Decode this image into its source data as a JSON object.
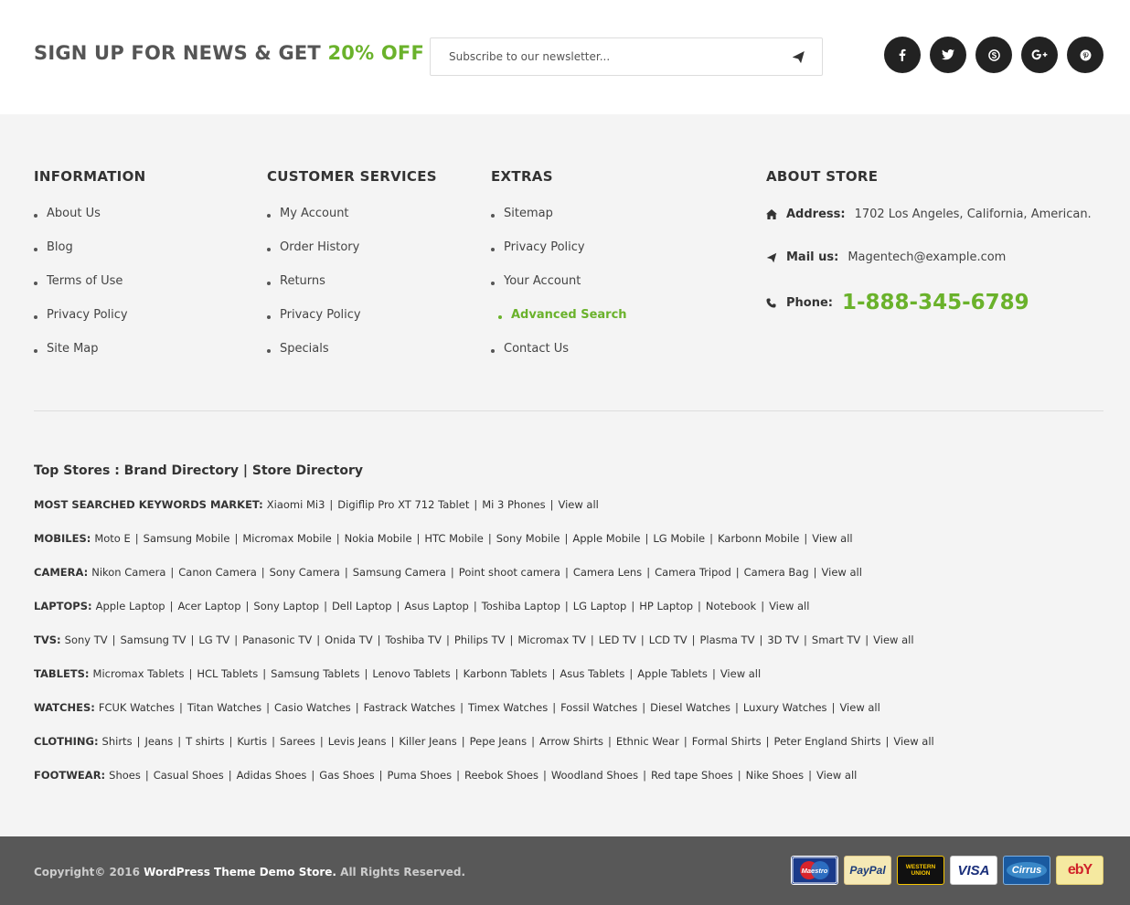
{
  "newsletter": {
    "title_prefix": "SIGN UP FOR NEWS & GET",
    "title_accent": "20% OFF",
    "placeholder": "Subscribe to our newsletter...",
    "social": [
      "facebook-icon",
      "twitter-icon",
      "skype-icon",
      "google-plus-icon",
      "pinterest-icon"
    ]
  },
  "columns": {
    "information": {
      "title": "INFORMATION",
      "items": [
        "About Us",
        "Blog",
        "Terms of Use",
        "Privacy Policy",
        "Site Map"
      ]
    },
    "customer_services": {
      "title": "CUSTOMER SERVICES",
      "items": [
        "My Account",
        "Order History",
        "Returns",
        "Privacy Policy",
        "Specials"
      ]
    },
    "extras": {
      "title": "EXTRAS",
      "items": [
        "Sitemap",
        "Privacy Policy",
        "Your Account",
        "Advanced Search",
        "Contact Us"
      ],
      "active_index": 3
    },
    "about": {
      "title": "ABOUT STORE",
      "address_label": "Address:",
      "address": "1702 Los Angeles, California, American.",
      "mail_label": "Mail us:",
      "mail": "Magentech@example.com",
      "phone_label": "Phone:",
      "phone": "1-888-345-6789"
    }
  },
  "stores": {
    "title": "Top Stores : Brand Directory | Store Directory",
    "rows": [
      {
        "category": "MOST SEARCHED KEYWORDS MARKET:",
        "items": [
          "Xiaomi Mi3",
          "Digiflip Pro XT 712 Tablet",
          "Mi 3 Phones",
          "View all"
        ]
      },
      {
        "category": "MOBILES:",
        "items": [
          "Moto E",
          "Samsung Mobile",
          "Micromax Mobile",
          "Nokia Mobile",
          "HTC Mobile",
          "Sony Mobile",
          "Apple Mobile",
          "LG Mobile",
          "Karbonn Mobile",
          "View all"
        ]
      },
      {
        "category": "CAMERA:",
        "items": [
          "Nikon Camera",
          "Canon Camera",
          "Sony Camera",
          "Samsung Camera",
          "Point shoot camera",
          "Camera Lens",
          "Camera Tripod",
          "Camera Bag",
          "View all"
        ]
      },
      {
        "category": "LAPTOPS:",
        "items": [
          "Apple Laptop",
          "Acer Laptop",
          "Sony Laptop",
          "Dell Laptop",
          "Asus Laptop",
          "Toshiba Laptop",
          "LG Laptop",
          "HP Laptop",
          "Notebook",
          "View all"
        ]
      },
      {
        "category": "TVS:",
        "items": [
          "Sony TV",
          "Samsung TV",
          "LG TV",
          "Panasonic TV",
          "Onida TV",
          "Toshiba TV",
          "Philips TV",
          "Micromax TV",
          "LED TV",
          "LCD TV",
          "Plasma TV",
          "3D TV",
          "Smart TV",
          "View all"
        ]
      },
      {
        "category": "TABLETS:",
        "items": [
          "Micromax Tablets",
          "HCL Tablets",
          "Samsung Tablets",
          "Lenovo Tablets",
          "Karbonn Tablets",
          "Asus Tablets",
          "Apple Tablets",
          "View all"
        ]
      },
      {
        "category": "WATCHES:",
        "items": [
          "FCUK Watches",
          "Titan Watches",
          "Casio Watches",
          "Fastrack Watches",
          "Timex Watches",
          "Fossil Watches",
          "Diesel Watches",
          "Luxury Watches",
          "View all"
        ]
      },
      {
        "category": "CLOTHING:",
        "items": [
          "Shirts",
          "Jeans",
          "T shirts",
          "Kurtis",
          "Sarees",
          "Levis Jeans",
          "Killer Jeans",
          "Pepe Jeans",
          "Arrow Shirts",
          "Ethnic Wear",
          "Formal Shirts",
          "Peter England Shirts",
          "View all"
        ]
      },
      {
        "category": "FOOTWEAR:",
        "items": [
          "Shoes",
          "Casual Shoes",
          "Adidas Shoes",
          "Gas Shoes",
          "Puma Shoes",
          "Reebok Shoes",
          "Woodland Shoes",
          "Red tape Shoes",
          "Nike Shoes",
          "View all"
        ]
      }
    ]
  },
  "bottom": {
    "copyright_prefix": "Copyright© 2016",
    "store_name": "WordPress Theme Demo Store.",
    "copyright_suffix": "All Rights Reserved.",
    "payments": [
      {
        "name": "maestro-icon",
        "text": "Maestro"
      },
      {
        "name": "paypal-icon",
        "text": "PayPal"
      },
      {
        "name": "western-union-icon",
        "text": "WESTERN UNION"
      },
      {
        "name": "visa-icon",
        "text": "VISA"
      },
      {
        "name": "cirrus-icon",
        "text": "Cirrus"
      },
      {
        "name": "ebay-icon",
        "text": "ebY"
      }
    ]
  },
  "colors": {
    "accent": "#6ab22b",
    "social_bg": "#222222",
    "bottom_bg": "#585858"
  }
}
